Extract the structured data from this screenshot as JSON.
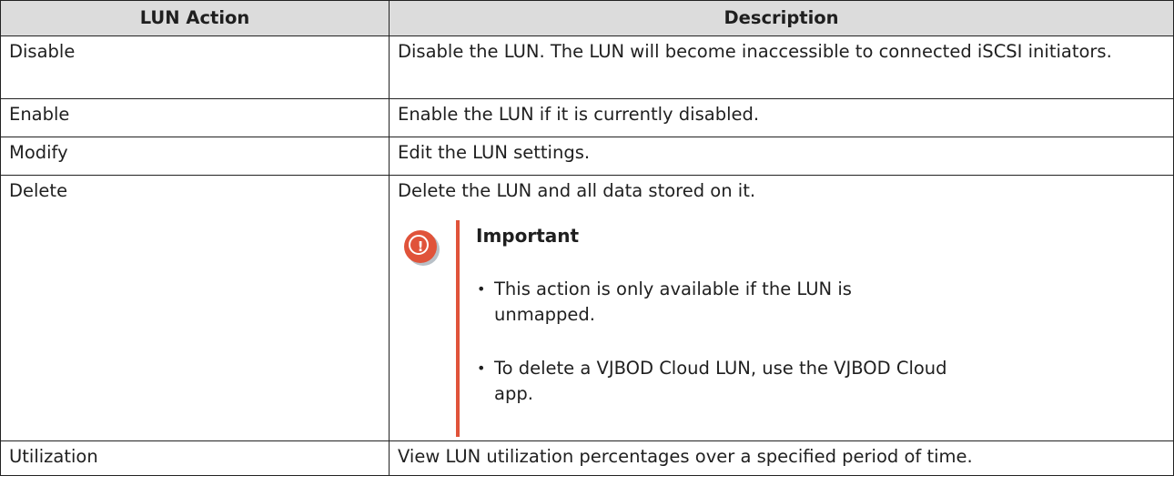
{
  "table": {
    "headers": [
      "LUN Action",
      "Description"
    ],
    "rows": [
      {
        "action": "Disable",
        "description": "Disable the LUN. The LUN will become inaccessible to connected iSCSI initiators."
      },
      {
        "action": "Enable",
        "description": "Enable the LUN if it is currently disabled."
      },
      {
        "action": "Modify",
        "description": "Edit the LUN settings."
      },
      {
        "action": "Delete",
        "description": "Delete the LUN and all data stored on it."
      },
      {
        "action": "Utilization",
        "description": "View LUN utilization percentages over a specified period of time."
      }
    ]
  },
  "important": {
    "icon": "exclamation-icon",
    "accent_color": "#e0533a",
    "title": "Important",
    "items": [
      "This action is only available if the LUN is unmapped.",
      "To delete a VJBOD Cloud LUN, use the VJBOD Cloud app."
    ]
  }
}
